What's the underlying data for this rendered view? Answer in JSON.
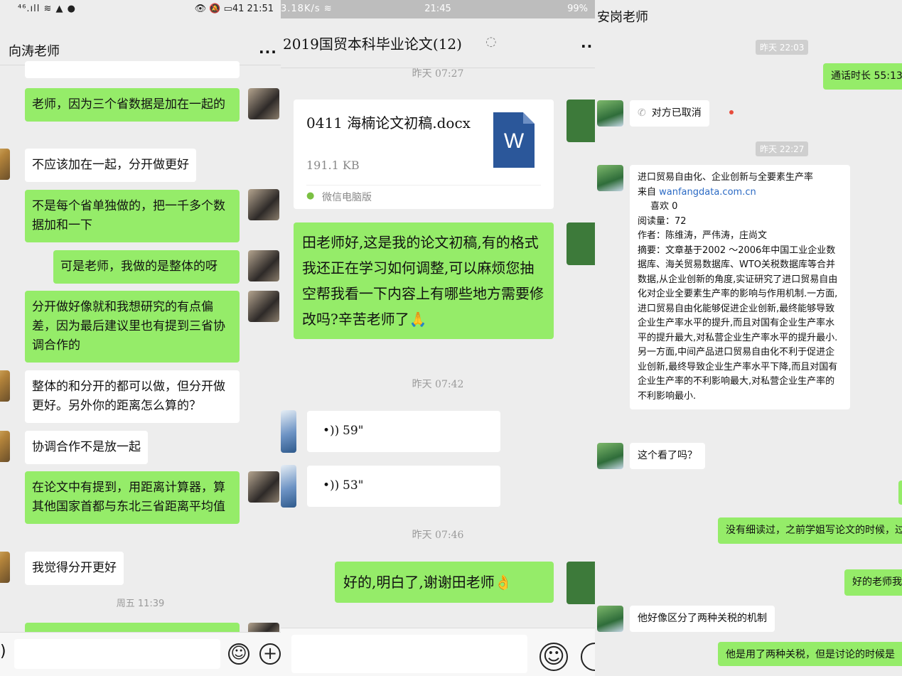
{
  "panel1": {
    "status": {
      "signal": "⁴⁶.ıll ≋ ▲ ●",
      "right": "👁 🔕 ▭41 21:51"
    },
    "title": "向涛老师",
    "more": "...",
    "partial_top": "",
    "messages": [
      {
        "side": "right",
        "text": "老师，因为三个省数据是加在一起的"
      },
      {
        "side": "left",
        "text": "不应该加在一起，分开做更好"
      },
      {
        "side": "right",
        "text": "不是每个省单独做的，把一千多个数据加和一下"
      },
      {
        "side": "right",
        "text": "可是老师，我做的是整体的呀"
      },
      {
        "side": "right",
        "text": "分开做好像就和我想研究的有点偏差，因为最后建议里也有提到三省协调合作的"
      },
      {
        "side": "left",
        "text": "整体的和分开的都可以做，但分开做更好。另外你的距离怎么算的？"
      },
      {
        "side": "left",
        "text": "协调合作不是放一起"
      },
      {
        "side": "right",
        "text": "在论文中有提到，用距离计算器，算其他国家首都与东北三省距离平均值"
      },
      {
        "side": "left",
        "text": "我觉得分开更好"
      }
    ],
    "timestamp": "周五 11:39",
    "input": {
      "emoji": "☺",
      "plus": "+",
      "left_glyph": ")"
    }
  },
  "panel2": {
    "status": {
      "left": "3.18K/s ≋",
      "center": "21:45",
      "right": "99%"
    },
    "title": "2019国贸本科毕业论文(12)",
    "ear_icon": "ear-icon",
    "more": "..",
    "ts1": "昨天 07:27",
    "file": {
      "name": "0411 海楠论文初稿.docx",
      "size": "191.1 KB",
      "source": "微信电脑版",
      "icon_letter": "W"
    },
    "msg_main": "田老师好,这是我的论文初稿,有的格式我还正在学习如何调整,可以麻烦您抽空帮我看一下内容上有哪些地方需要修改吗?辛苦老师了🙏",
    "ts2": "昨天 07:42",
    "voices": [
      {
        "duration": "59\""
      },
      {
        "duration": "53\""
      }
    ],
    "ts3": "昨天 07:46",
    "msg_reply": "好的,明白了,谢谢田老师👌",
    "input": {
      "emoji": "☺"
    }
  },
  "panel3": {
    "title": "安岗老师",
    "ts1": "昨天 22:03",
    "call_duration": "通话时长 55:13",
    "call_cancel": "对方已取消",
    "ts2": "昨天 22:27",
    "article": {
      "title": "进口贸易自由化、企业创新与全要素生产率",
      "source_prefix": "来自 ",
      "source_link": "wanfangdata.com.cn",
      "likes": "喜欢 0",
      "reads": "阅读量：72",
      "authors": "作者：陈维涛，严伟涛，庄尚文",
      "abstract": "摘要：文章基于2002 ～2006年中国工业企业数据库、海关贸易数据库、WTO关税数据库等合并数据,从企业创新的角度,实证研究了进口贸易自由化对企业全要素生产率的影响与作用机制.一方面,进口贸易自由化能够促进企业创新,最终能够导致企业生产率水平的提升,而且对国有企业生产率水平的提升最大,对私营企业生产率水平的提升最小.另一方面,中间产品进口贸易自由化不利于促进企业创新,最终导致企业生产率水平下降,而且对国有企业生产率的不利影响最大,对私营企业生产率的不利影响最小."
    },
    "q1": "这个看了吗？",
    "r1": "没有细读过，之前学姐写论文的时候，过把产品创新作为关税->TFP的中介变",
    "r2": "好的老师我",
    "q2": "他好像区分了两种关税的机制",
    "r3": "他是用了两种关税，但是讨论的时候是"
  }
}
